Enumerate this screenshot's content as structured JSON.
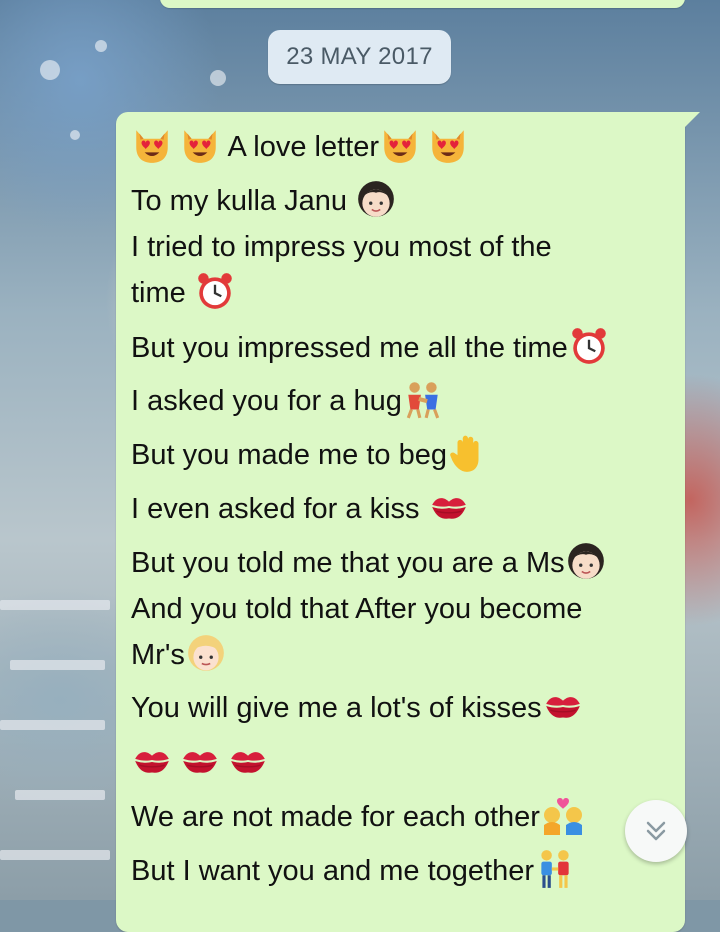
{
  "date_divider": "23 MAY 2017",
  "message": {
    "lines": [
      {
        "text": " A love letter",
        "emojis_before": [
          "heart-eyes-cat",
          "heart-eyes-cat"
        ],
        "emojis_after": [
          "heart-eyes-cat",
          "heart-eyes-cat"
        ]
      },
      {
        "text": "To my kulla Janu ",
        "emojis_after": [
          "girl"
        ]
      },
      {
        "text": "I tried to impress you most of the"
      },
      {
        "text": "time ",
        "emojis_after": [
          "alarm-clock"
        ]
      },
      {
        "text": "But you impressed me all the time",
        "emojis_after": [
          "alarm-clock"
        ]
      },
      {
        "text": "I asked you for a hug",
        "emojis_after": [
          "wrestlers"
        ]
      },
      {
        "text": "But you made me to beg",
        "emojis_after": [
          "raised-hand"
        ]
      },
      {
        "text": "I even asked for a kiss ",
        "emojis_after": [
          "kiss-mark"
        ]
      },
      {
        "text": "But you told  me that you are a Ms",
        "emojis_after": [
          "girl"
        ]
      },
      {
        "text": " And you told that After you  become"
      },
      {
        "text": "Mr's",
        "emojis_after": [
          "blond-person"
        ]
      },
      {
        "text": "You will give me a lot's of kisses",
        "emojis_after": [
          "kiss-mark"
        ]
      },
      {
        "text": "",
        "emojis_after": [
          "kiss-mark",
          "kiss-mark",
          "kiss-mark"
        ]
      },
      {
        "text": "We are not made for each other",
        "emojis_after": [
          "kiss-couple"
        ]
      },
      {
        "text": "But I want you and me  together",
        "emojis_after": [
          "couple-holding-hands"
        ]
      }
    ]
  },
  "scroll_button": {
    "icon": "double-chevron-down-icon"
  },
  "colors": {
    "bubble": "#dcf8c6",
    "date_pill": "#dfeaf3",
    "text": "#111111"
  }
}
